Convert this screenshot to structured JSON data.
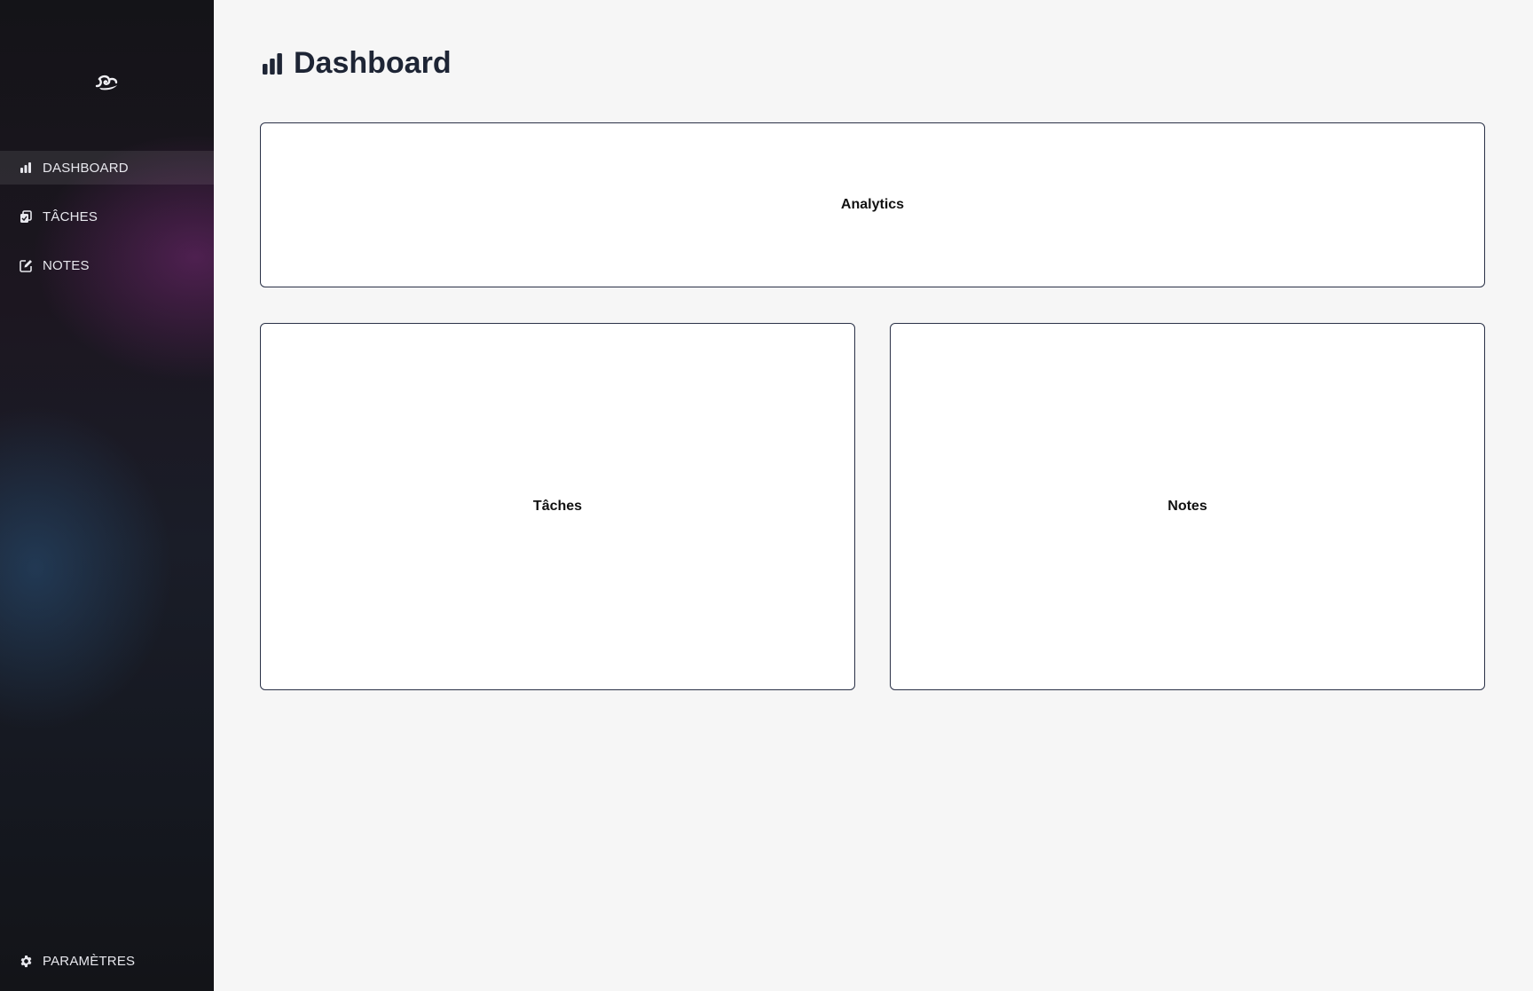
{
  "sidebar": {
    "logo_icon": "wave-logo-icon",
    "items": [
      {
        "label": "DASHBOARD",
        "icon": "bar-chart-icon",
        "active": true
      },
      {
        "label": "TÂCHES",
        "icon": "clipboard-icon",
        "active": false
      },
      {
        "label": "NOTES",
        "icon": "edit-note-icon",
        "active": false
      }
    ],
    "settings": {
      "label": "PARAMÈTRES",
      "icon": "gear-icon"
    }
  },
  "header": {
    "title": "Dashboard",
    "icon": "bar-chart-icon"
  },
  "cards": {
    "analytics": "Analytics",
    "taches": "Tâches",
    "notes": "Notes"
  },
  "colors": {
    "background": "#f6f6f6",
    "title": "#1e2535",
    "card_border": "#2a3147"
  }
}
